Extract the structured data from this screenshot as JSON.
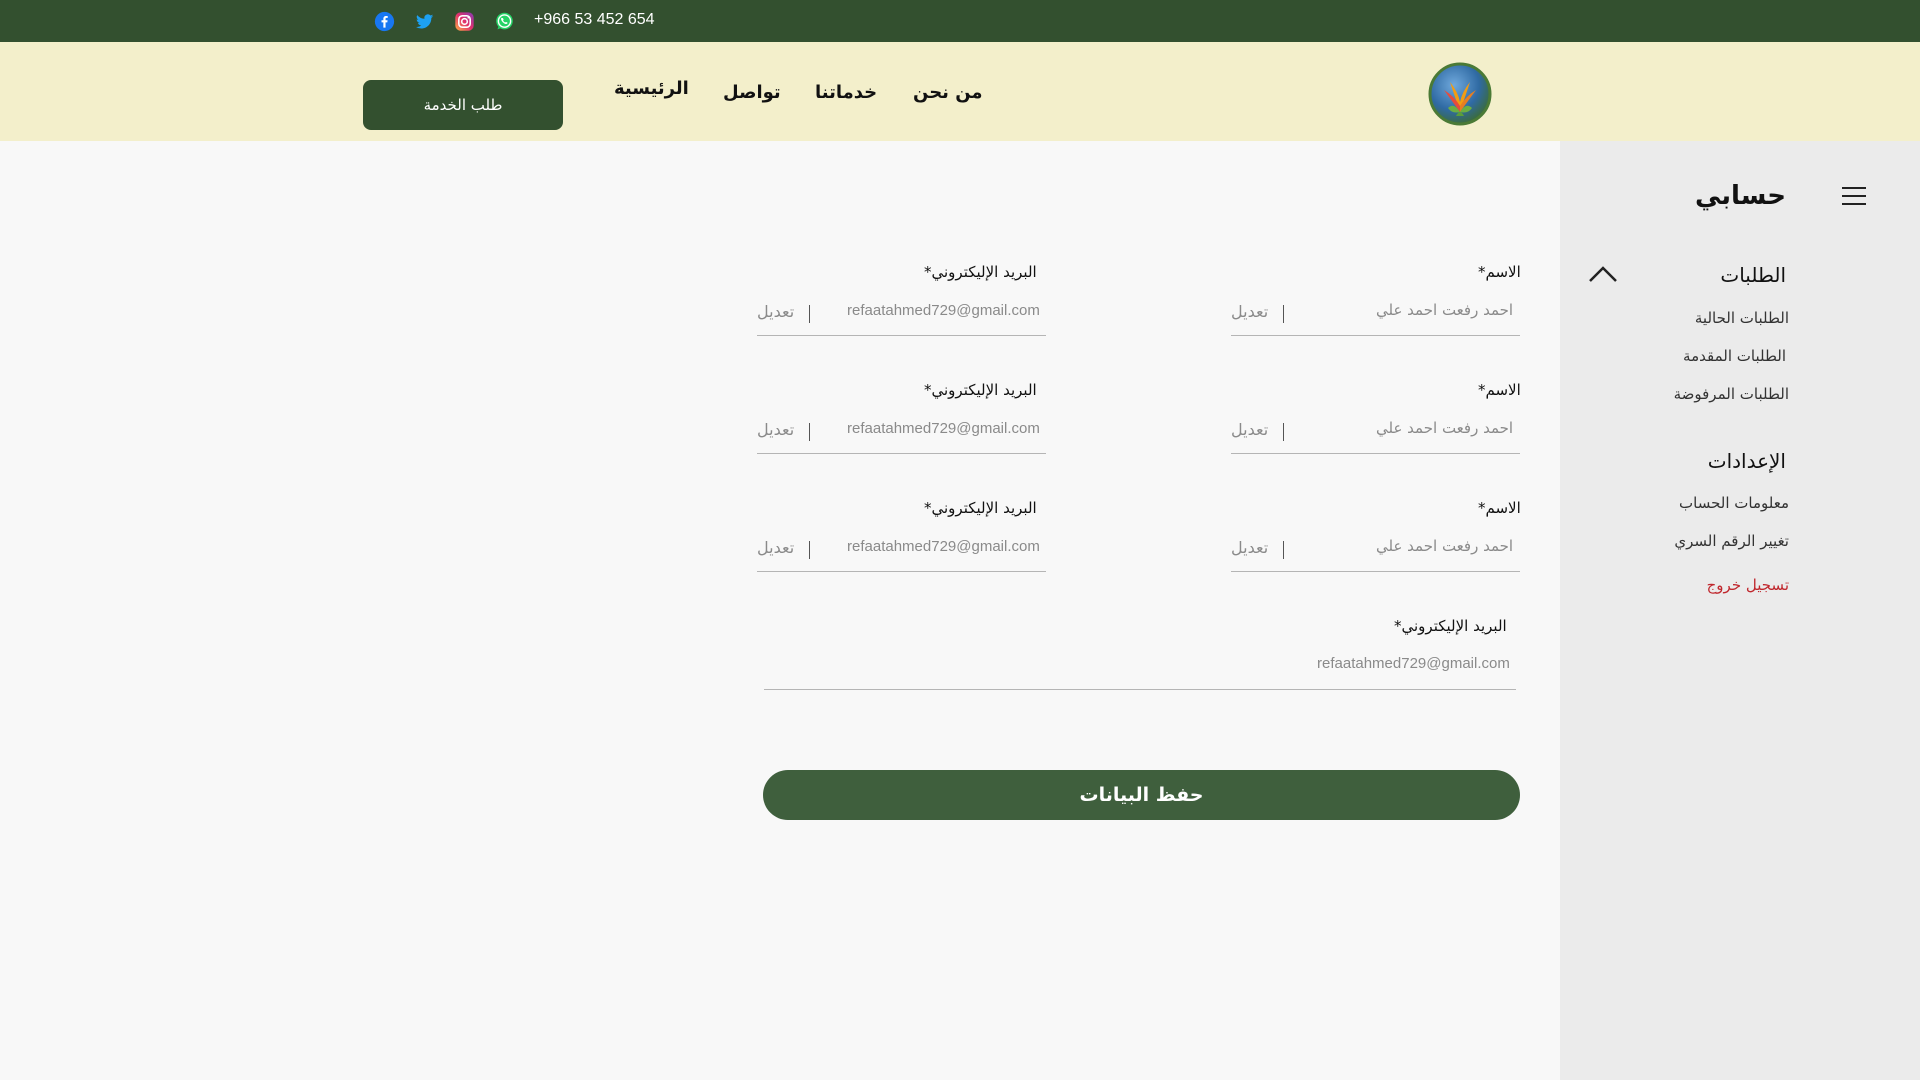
{
  "topbar": {
    "phone": "+966 53 452 654",
    "icons": [
      "facebook-icon",
      "twitter-icon",
      "instagram-icon",
      "whatsapp-icon"
    ]
  },
  "header": {
    "cta_label": "طلب الخدمة",
    "nav": {
      "home": "الرئيسية",
      "contact": "تواصل",
      "services": "خدماتنا",
      "about": "من نحن"
    }
  },
  "sidebar": {
    "title": "حسابي",
    "requests_heading": "الطلبات",
    "requests_items": [
      "الطلبات الحالية",
      "الطلبات المقدمة",
      "الطلبات المرفوضة"
    ],
    "settings_heading": "الإعدادات",
    "settings_items": [
      "معلومات الحساب",
      "تغيير الرقم السري"
    ],
    "logout": "تسجيل خروج"
  },
  "form": {
    "rows": [
      {
        "name_label": "الاسم*",
        "name_value": "احمد رفعت احمد علي",
        "email_label": "البريد الإليكتروني*",
        "email_value": "refaatahmed729@gmail.com"
      },
      {
        "name_label": "الاسم*",
        "name_value": "احمد رفعت احمد علي",
        "email_label": "البريد الإليكتروني*",
        "email_value": "refaatahmed729@gmail.com"
      },
      {
        "name_label": "الاسم*",
        "name_value": "احمد رفعت احمد علي",
        "email_label": "البريد الإليكتروني*",
        "email_value": "refaatahmed729@gmail.com"
      }
    ],
    "edit_label": "تعديل",
    "full_email_label": "البريد الإليكتروني*",
    "full_email_value": "refaatahmed729@gmail.com",
    "save_label": "حفظ البيانات"
  },
  "colors": {
    "topbar": "#33502f",
    "header": "#f3efcb",
    "primary_button": "#33502f",
    "save_button": "#3f5f3d",
    "sidebar": "#ebebeb",
    "logout": "#c0272d"
  }
}
